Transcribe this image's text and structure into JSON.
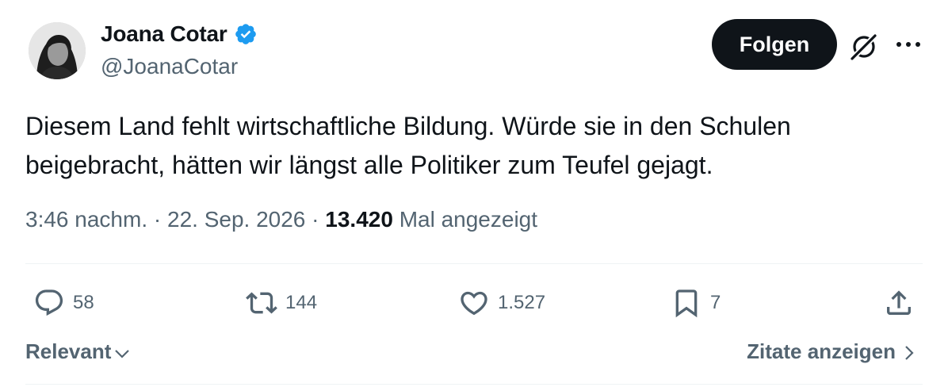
{
  "author": {
    "name": "Joana Cotar",
    "handle": "@JoanaCotar"
  },
  "header": {
    "follow_label": "Folgen"
  },
  "tweet": {
    "text_line1": "Diesem Land fehlt wirtschaftliche Bildung. Würde sie in den Schulen",
    "text_line2": "beigebracht, hätten wir längst alle Politiker zum Teufel gejagt.",
    "time": "3:46 nachm.",
    "separator": "·",
    "date": "22. Sep. 2026",
    "views_count": "13.420",
    "views_label": "Mal angezeigt"
  },
  "actions": {
    "replies": "58",
    "reposts": "144",
    "likes": "1.527",
    "bookmarks": "7"
  },
  "footer": {
    "sort_label": "Relevant",
    "quotes_label": "Zitate anzeigen"
  },
  "colors": {
    "text_primary": "#0f1419",
    "text_secondary": "#536471",
    "verified_blue": "#1d9bf0",
    "divider": "#eff3f4",
    "follow_button_bg": "#0f1419"
  }
}
